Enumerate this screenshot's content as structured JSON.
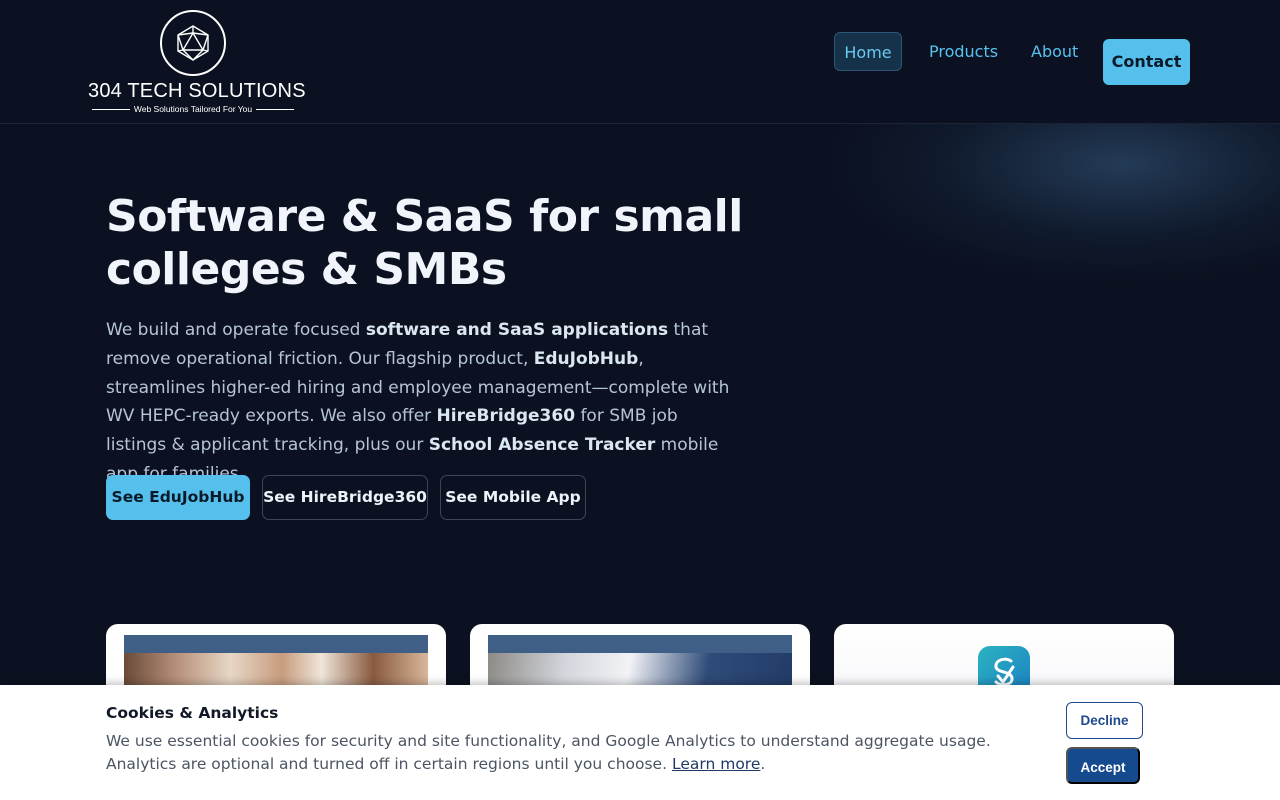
{
  "brand": {
    "name": "304 TECH SOLUTIONS",
    "tagline": "Web Solutions Tailored For You",
    "logo_icon": "icosahedron-icon"
  },
  "nav": {
    "home": "Home",
    "products": "Products",
    "about": "About",
    "contact": "Contact"
  },
  "hero": {
    "title": "Software & SaaS for small colleges & SMBs",
    "body": [
      {
        "t": "We build and operate focused ",
        "b": false
      },
      {
        "t": "software and SaaS applications",
        "b": true
      },
      {
        "t": " that remove operational friction. Our flagship product, ",
        "b": false
      },
      {
        "t": "EduJobHub",
        "b": true
      },
      {
        "t": ", streamlines higher-ed hiring and employee management—complete with WV HEPC-ready exports. We also offer ",
        "b": false
      },
      {
        "t": "HireBridge360",
        "b": true
      },
      {
        "t": " for SMB job listings & applicant tracking, plus our ",
        "b": false
      },
      {
        "t": "School Absence Tracker",
        "b": true
      },
      {
        "t": " mobile app for families.",
        "b": false
      }
    ],
    "buttons": {
      "edujobhub": "See EduJobHub",
      "hirebridge": "See HireBridge360",
      "mobile": "See Mobile App"
    }
  },
  "cards": [
    {
      "name": "edujobhub-preview"
    },
    {
      "name": "hirebridge360-preview"
    },
    {
      "name": "school-absence-tracker-preview",
      "icon": "app-check-icon"
    }
  ],
  "cookie": {
    "title": "Cookies & Analytics",
    "text": "We use essential cookies for security and site functionality, and Google Analytics to understand aggregate usage. Analytics are optional and turned off in certain regions until you choose.",
    "link": "Learn more",
    "link_suffix": ".",
    "decline": "Decline",
    "accept": "Accept"
  },
  "colors": {
    "background": "#0b1120",
    "accent": "#55c0ec",
    "accept_button": "#164a8f"
  }
}
